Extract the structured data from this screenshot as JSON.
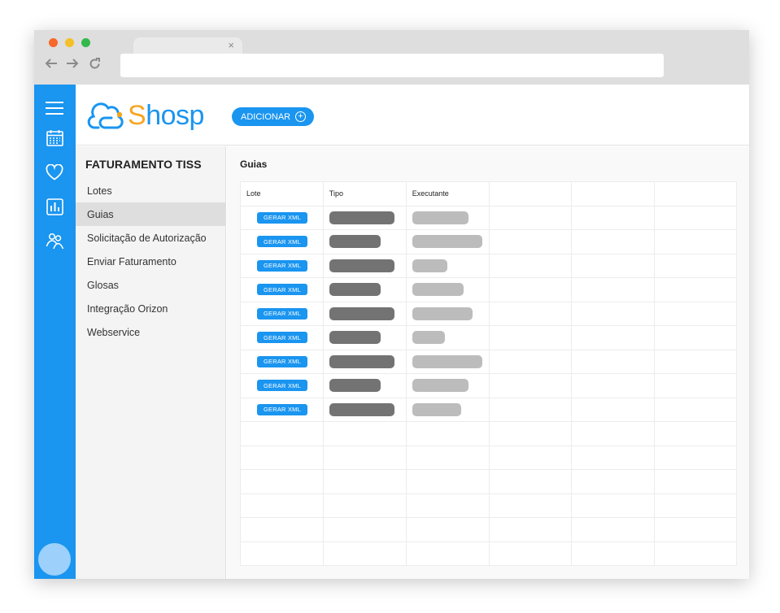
{
  "browser": {
    "tab_close": "×",
    "url": ""
  },
  "icons": {
    "back": "arrow-left",
    "forward": "arrow-right",
    "reload": "reload",
    "rail": [
      "menu",
      "calendar",
      "heart",
      "bar-chart",
      "team"
    ]
  },
  "header": {
    "logo_text_first": "S",
    "logo_text_rest": "hosp",
    "add_button_label": "ADICIONAR"
  },
  "sidemenu": {
    "title": "FATURAMENTO TISS",
    "items": [
      {
        "label": "Lotes",
        "active": false
      },
      {
        "label": "Guias",
        "active": true
      },
      {
        "label": "Solicitação de Autorização",
        "active": false
      },
      {
        "label": "Enviar Faturamento",
        "active": false
      },
      {
        "label": "Glosas",
        "active": false
      },
      {
        "label": "Integração Orizon",
        "active": false
      },
      {
        "label": "Webservice",
        "active": false
      }
    ]
  },
  "main": {
    "title": "Guias",
    "columns": [
      "Lote",
      "Tipo",
      "Executante",
      "",
      "",
      ""
    ],
    "row_button_label": "GERAR XML",
    "filled_rows": 9,
    "empty_rows": 6
  },
  "colors": {
    "accent": "#1a95f0",
    "logo_orange": "#f5a623",
    "placeholder_dark": "#737373",
    "placeholder_light": "#bcbcbc"
  }
}
